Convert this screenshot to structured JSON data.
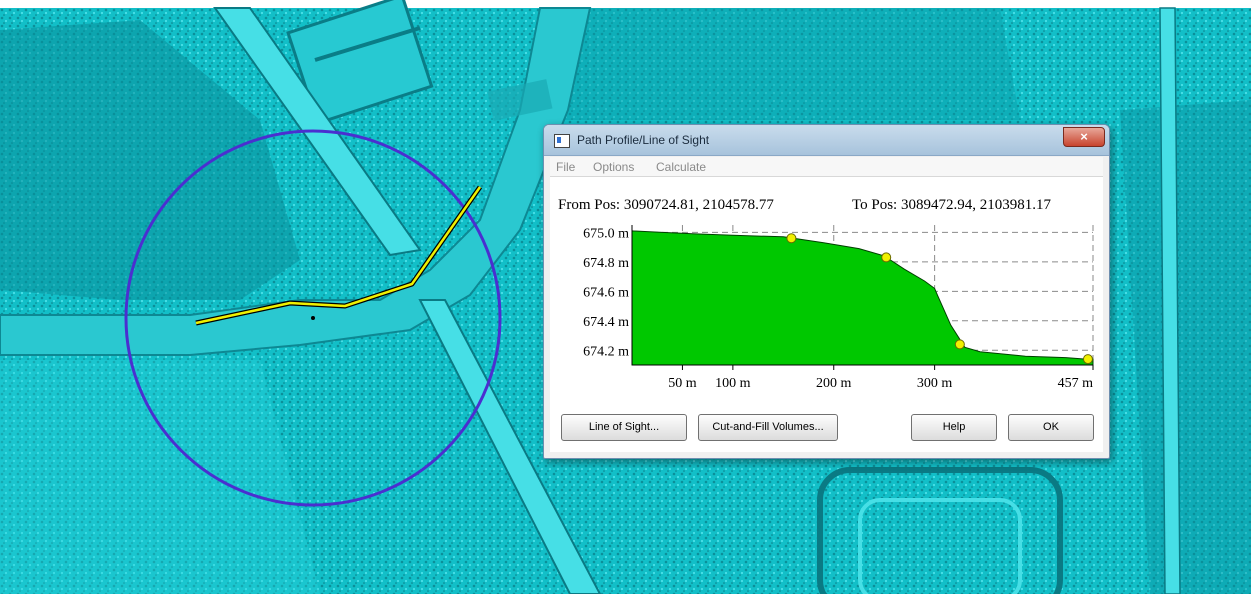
{
  "dialog": {
    "title": "Path Profile/Line of Sight",
    "close_glyph": "×",
    "menu": [
      "File",
      "Options",
      "Calculate"
    ],
    "from_pos": "From Pos: 3090724.81, 2104578.77",
    "to_pos": "To Pos: 3089472.94, 2103981.17",
    "buttons": {
      "line_of_sight": "Line of Sight...",
      "cut_fill": "Cut-and-Fill Volumes...",
      "help": "Help",
      "ok": "OK"
    }
  },
  "colors": {
    "terrain_fill": "#00c800",
    "path_line": "#f0f000",
    "buffer_circle": "#4a2fd0",
    "hillshade": "#14c3cc"
  },
  "chart_data": {
    "type": "area",
    "title": "",
    "xlabel": "",
    "ylabel": "",
    "xlim": [
      0,
      457
    ],
    "ylim": [
      674.1,
      675.05
    ],
    "x_ticks": [
      50,
      100,
      200,
      300,
      457
    ],
    "x_tick_labels": [
      "50 m",
      "100 m",
      "200 m",
      "300 m",
      "457 m"
    ],
    "y_ticks": [
      674.2,
      674.4,
      674.6,
      674.8,
      675.0
    ],
    "y_tick_labels": [
      "674.2 m",
      "674.4 m",
      "674.6 m",
      "674.8 m",
      "675.0 m"
    ],
    "grid": true,
    "series": [
      {
        "x": [
          0,
          30,
          60,
          100,
          150,
          160,
          190,
          225,
          250,
          270,
          290,
          300,
          303,
          316,
          330,
          345,
          390,
          430,
          450,
          457
        ],
        "y": [
          675.01,
          675.0,
          674.99,
          674.98,
          674.97,
          674.96,
          674.93,
          674.89,
          674.84,
          674.75,
          674.67,
          674.62,
          674.57,
          674.37,
          674.22,
          674.19,
          674.16,
          674.15,
          674.14,
          674.14
        ]
      }
    ],
    "markers": [
      {
        "x": 158,
        "y": 674.96
      },
      {
        "x": 252,
        "y": 674.83
      },
      {
        "x": 325,
        "y": 674.24
      },
      {
        "x": 452,
        "y": 674.14
      }
    ]
  }
}
